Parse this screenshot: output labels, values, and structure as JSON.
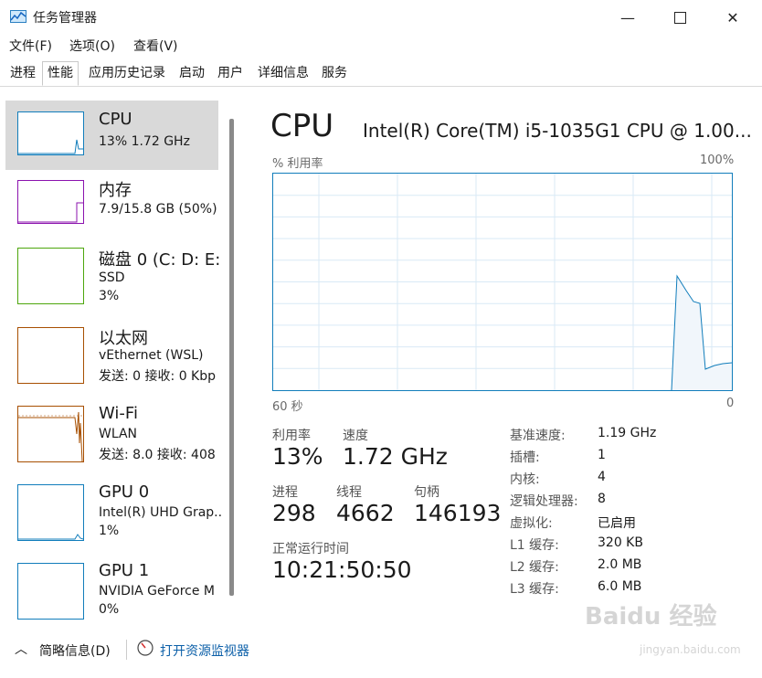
{
  "window": {
    "title": "任务管理器"
  },
  "menu": [
    "文件(F)",
    "选项(O)",
    "查看(V)"
  ],
  "tabs": [
    "进程",
    "性能",
    "应用历史记录",
    "启动",
    "用户",
    "详细信息",
    "服务"
  ],
  "active_tab": "性能",
  "sidebar": [
    {
      "name": "CPU",
      "line1": "13%  1.72 GHz",
      "line2": "",
      "color": "#117dbb"
    },
    {
      "name": "内存",
      "line1": "7.9/15.8 GB (50%)",
      "line2": "",
      "color": "#8b12ae"
    },
    {
      "name": "磁盘 0 (C: D: E:",
      "line1": "SSD",
      "line2": "3%",
      "color": "#4da60c"
    },
    {
      "name": "以太网",
      "line1": "vEthernet (WSL)",
      "line2": "发送: 0 接收: 0 Kbp",
      "color": "#a74f01"
    },
    {
      "name": "Wi-Fi",
      "line1": "WLAN",
      "line2": "发送: 8.0 接收: 408",
      "color": "#a74f01"
    },
    {
      "name": "GPU 0",
      "line1": "Intel(R) UHD Grap..",
      "line2": "1%",
      "color": "#117dbb"
    },
    {
      "name": "GPU 1",
      "line1": "NVIDIA GeForce M",
      "line2": "0%",
      "color": "#117dbb"
    }
  ],
  "main": {
    "title": "CPU",
    "model": "Intel(R) Core(TM) i5-1035G1 CPU @ 1.00...",
    "graph_label_left": "% 利用率",
    "graph_label_right": "100%",
    "graph_bottom_left": "60 秒",
    "graph_bottom_right": "0",
    "utilization_label": "利用率",
    "utilization": "13%",
    "speed_label": "速度",
    "speed": "1.72 GHz",
    "processes_label": "进程",
    "processes": "298",
    "threads_label": "线程",
    "threads": "4662",
    "handles_label": "句柄",
    "handles": "146193",
    "uptime_label": "正常运行时间",
    "uptime": "10:21:50:50"
  },
  "specs": [
    {
      "label": "基准速度:",
      "value": "1.19 GHz"
    },
    {
      "label": "插槽:",
      "value": "1"
    },
    {
      "label": "内核:",
      "value": "4"
    },
    {
      "label": "逻辑处理器:",
      "value": "8"
    },
    {
      "label": "虚拟化:",
      "value": "已启用"
    },
    {
      "label": "L1 缓存:",
      "value": "320 KB"
    },
    {
      "label": "L2 缓存:",
      "value": "2.0 MB"
    },
    {
      "label": "L3 缓存:",
      "value": "6.0 MB"
    }
  ],
  "footer": {
    "summary": "简略信息(D)",
    "monitor_link": "打开资源监视器"
  },
  "watermark": {
    "brand": "Baidu 经验",
    "url": "jingyan.baidu.com"
  }
}
